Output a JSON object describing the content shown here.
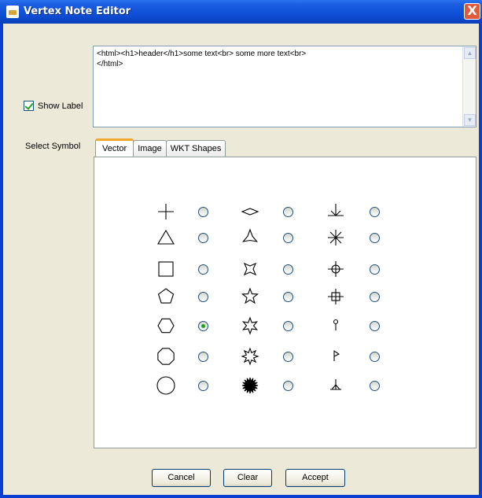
{
  "window": {
    "title": "Vertex Note Editor",
    "close_glyph": "X"
  },
  "label_section": {
    "show_label": "Show Label",
    "show_label_checked": true,
    "text": "<html><h1>header</h1>some text<br> some more text<br>\n</html>"
  },
  "symbol_section": {
    "label": "Select Symbol",
    "tabs": [
      "Vector",
      "Image",
      "WKT Shapes"
    ],
    "active_tab": "Vector",
    "selected": "hexagon",
    "columns": [
      [
        "cross",
        "triangle",
        "square",
        "pentagon",
        "hexagon",
        "octagon",
        "circle"
      ],
      [
        "diamond",
        "tri-star",
        "four-point-star",
        "five-point-star",
        "six-point-star",
        "eight-point-star",
        "sixteen-point-star"
      ],
      [
        "down-arrow-mark",
        "asterisk",
        "circle-cross",
        "square-cross",
        "pin",
        "flag",
        "stake"
      ]
    ]
  },
  "buttons": {
    "cancel": "Cancel",
    "clear": "Clear",
    "accept": "Accept"
  },
  "colors": {
    "title_bar": "#0a3fd1",
    "close_button": "#e2593b",
    "tab_highlight": "#f2a62e",
    "radio_selected": "#21a121"
  }
}
